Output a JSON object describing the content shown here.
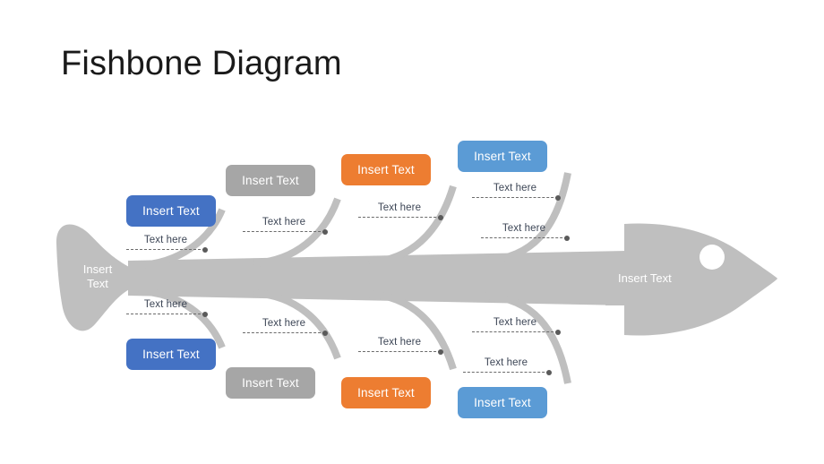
{
  "page": {
    "title": "Fishbone Diagram",
    "background_color": "#ffffff"
  },
  "palette": {
    "fish_gray": "#BFBFBF",
    "box_gray": "#A6A6A6",
    "box_blue_dark": "#4472C4",
    "box_blue_light": "#5B9BD5",
    "box_orange": "#ED7D31",
    "bone_gray": "#BFBFBF",
    "dash_line": "#6b6b6b",
    "dot": "#5a5a5a",
    "cause_text": "#3d4656",
    "box_text": "#ffffff",
    "title_text": "#1a1a1a"
  },
  "fish": {
    "tail_label": "Insert\nText",
    "head_label": "Insert Text",
    "eye": "fish-eye"
  },
  "categories": [
    {
      "id": "top-1",
      "label": "Insert Text",
      "color": "#4472C4",
      "side": "top",
      "index": 1
    },
    {
      "id": "top-2",
      "label": "Insert Text",
      "color": "#A6A6A6",
      "side": "top",
      "index": 2
    },
    {
      "id": "top-3",
      "label": "Insert Text",
      "color": "#ED7D31",
      "side": "top",
      "index": 3
    },
    {
      "id": "top-4",
      "label": "Insert Text",
      "color": "#5B9BD5",
      "side": "top",
      "index": 4
    },
    {
      "id": "bottom-1",
      "label": "Insert Text",
      "color": "#4472C4",
      "side": "bottom",
      "index": 1
    },
    {
      "id": "bottom-2",
      "label": "Insert Text",
      "color": "#A6A6A6",
      "side": "bottom",
      "index": 2
    },
    {
      "id": "bottom-3",
      "label": "Insert Text",
      "color": "#ED7D31",
      "side": "bottom",
      "index": 3
    },
    {
      "id": "bottom-4",
      "label": "Insert Text",
      "color": "#5B9BD5",
      "side": "bottom",
      "index": 4
    }
  ],
  "causes": [
    {
      "id": "t1-c1",
      "label": "Text here",
      "branch": "top-1"
    },
    {
      "id": "t2-c1",
      "label": "Text here",
      "branch": "top-2"
    },
    {
      "id": "t3-c1",
      "label": "Text here",
      "branch": "top-3"
    },
    {
      "id": "t4-c1",
      "label": "Text here",
      "branch": "top-4"
    },
    {
      "id": "t4-c2",
      "label": "Text here",
      "branch": "top-4"
    },
    {
      "id": "b1-c1",
      "label": "Text here",
      "branch": "bottom-1"
    },
    {
      "id": "b2-c1",
      "label": "Text here",
      "branch": "bottom-2"
    },
    {
      "id": "b3-c1",
      "label": "Text here",
      "branch": "bottom-3"
    },
    {
      "id": "b4-c1",
      "label": "Text here",
      "branch": "bottom-4"
    },
    {
      "id": "b4-c2",
      "label": "Text here",
      "branch": "bottom-4"
    }
  ]
}
